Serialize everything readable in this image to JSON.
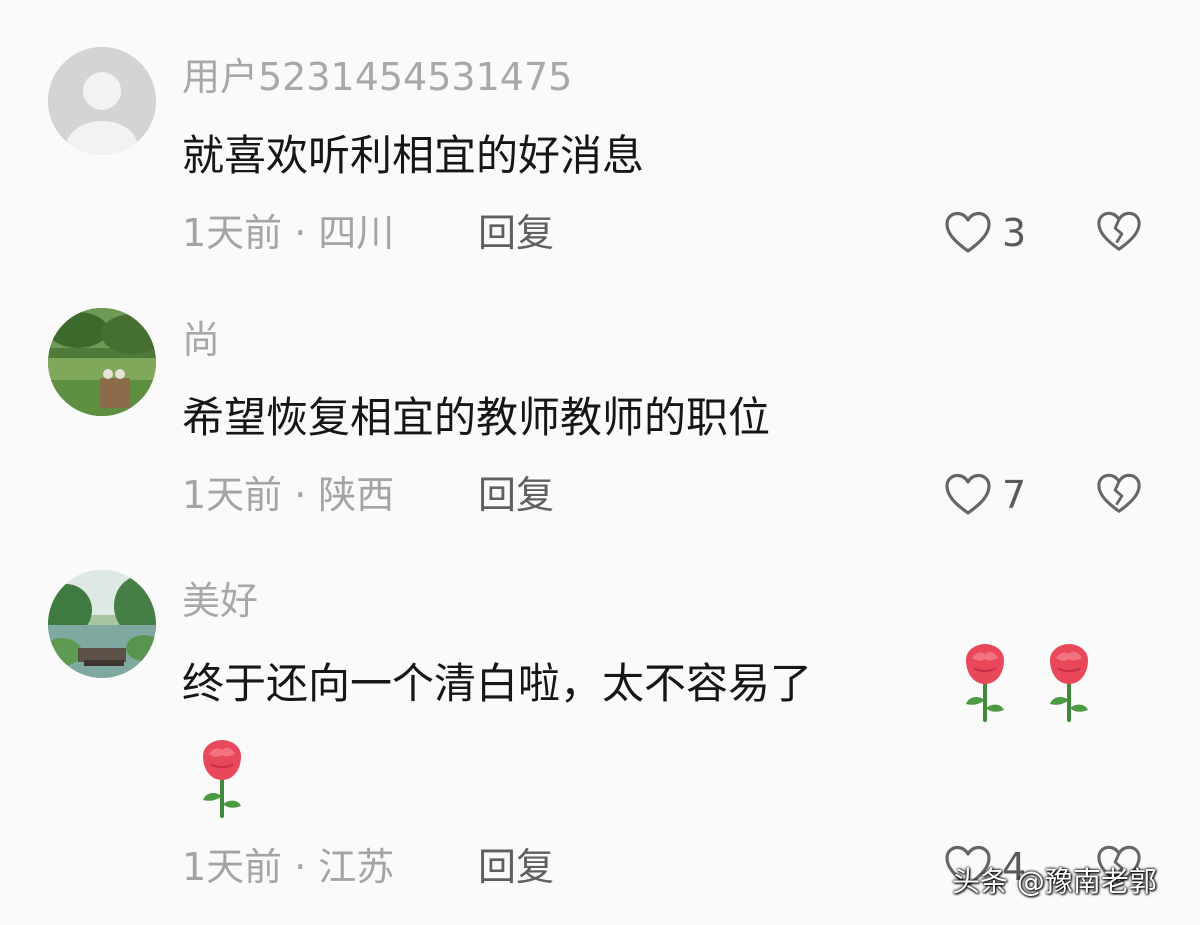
{
  "comments": [
    {
      "username": "用户5231454531475",
      "content": "就喜欢听利相宜的好消息",
      "time": "1天前",
      "separator": "·",
      "location": "四川",
      "reply_label": "回复",
      "likes": "3",
      "avatar": "default-avatar"
    },
    {
      "username": "尚",
      "content": "希望恢复相宜的教师教师的职位",
      "time": "1天前",
      "separator": "·",
      "location": "陕西",
      "reply_label": "回复",
      "likes": "7",
      "avatar": "landscape-photo-avatar"
    },
    {
      "username": "美好",
      "content": "终于还向一个清白啦，太不容易了",
      "time": "1天前",
      "separator": "·",
      "location": "江苏",
      "reply_label": "回复",
      "likes": "4",
      "avatar": "lake-photo-avatar",
      "emoji": [
        "rose",
        "rose",
        "rose"
      ]
    }
  ],
  "watermark": "头条 @豫南老郭",
  "colors": {
    "background": "#fafafa",
    "username": "#a8a8a8",
    "content": "#161616",
    "meta": "#a4a4a4",
    "reply": "#5f5f5f",
    "icon": "#666666"
  }
}
